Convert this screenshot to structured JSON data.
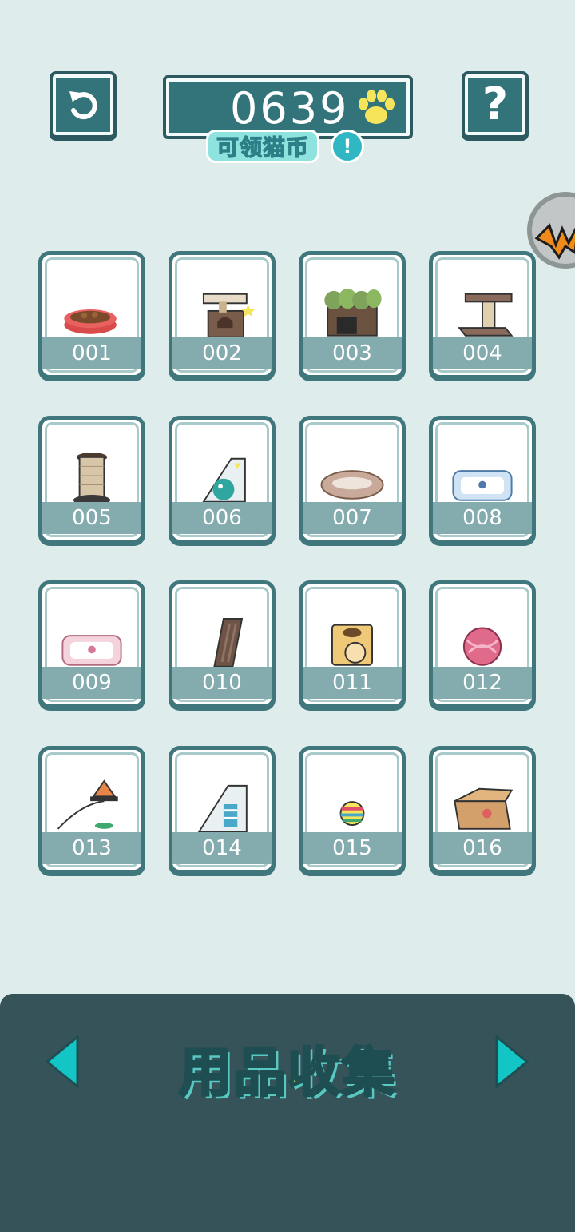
{
  "header": {
    "coin_count": "0639",
    "claim_label": "可领猫币",
    "info_symbol": "!",
    "help_symbol": "?"
  },
  "items": [
    {
      "id": "001",
      "icon": "food-bowl"
    },
    {
      "id": "002",
      "icon": "cat-box-tower"
    },
    {
      "id": "003",
      "icon": "grass-house"
    },
    {
      "id": "004",
      "icon": "scratching-post"
    },
    {
      "id": "005",
      "icon": "rope-spool"
    },
    {
      "id": "006",
      "icon": "ball-track-toy"
    },
    {
      "id": "007",
      "icon": "plush-ring-bed"
    },
    {
      "id": "008",
      "icon": "blue-cat-bed"
    },
    {
      "id": "009",
      "icon": "pink-cat-bed"
    },
    {
      "id": "010",
      "icon": "scratch-board"
    },
    {
      "id": "011",
      "icon": "cube-cat-house"
    },
    {
      "id": "012",
      "icon": "yarn-ball"
    },
    {
      "id": "013",
      "icon": "cat-teaser-wand"
    },
    {
      "id": "014",
      "icon": "fish-toy-box"
    },
    {
      "id": "015",
      "icon": "rainbow-ball"
    },
    {
      "id": "016",
      "icon": "cardboard-box"
    }
  ],
  "footer": {
    "title": "用品收集"
  },
  "colors": {
    "background": "#deecec",
    "card_border": "#3f777d",
    "label_band": "#84abad",
    "panel": "#355359",
    "arrow": "#13c5c5",
    "title": "#fff36c"
  }
}
